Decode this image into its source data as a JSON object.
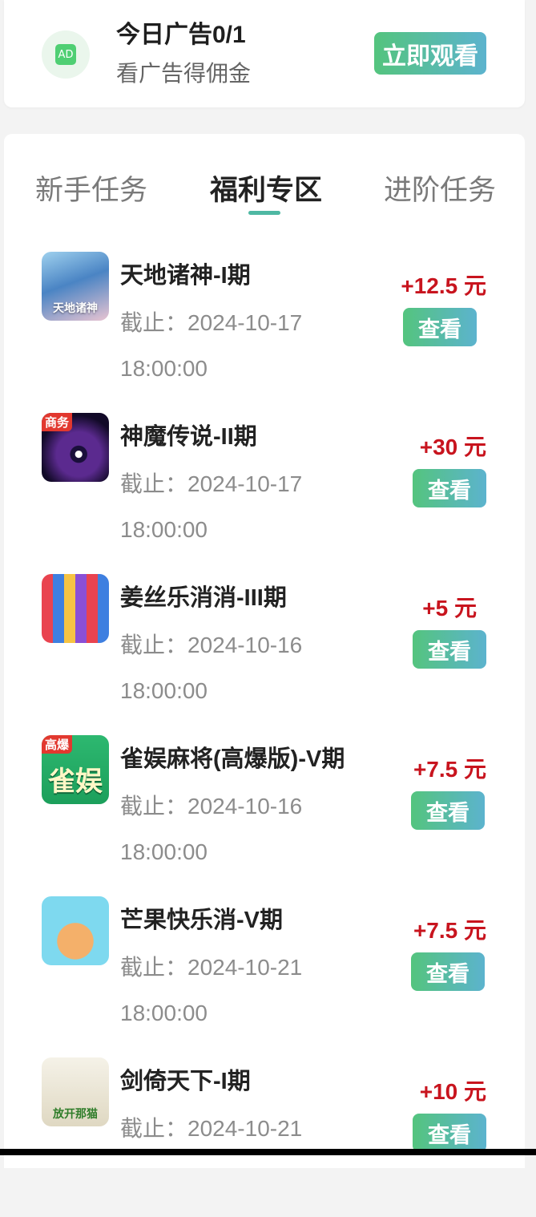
{
  "ad_card": {
    "icon_text": "AD",
    "icon_name": "ad-icon",
    "title": "今日广告0/1",
    "subtitle": "看广告得佣金",
    "watch_button": "立即观看"
  },
  "tabs": [
    {
      "label": "新手任务",
      "active": false
    },
    {
      "label": "福利专区",
      "active": true
    },
    {
      "label": "进阶任务",
      "active": false
    }
  ],
  "tasks": [
    {
      "name": "天地诸神-I期",
      "deadline_label": "截止：",
      "deadline_date": "2024-10-17",
      "deadline_time": "18:00:00",
      "reward": "+12.5 元",
      "button": "查看",
      "thumb_text": "天地诸神"
    },
    {
      "name": "神魔传说-II期",
      "deadline_label": "截止：",
      "deadline_date": "2024-10-17",
      "deadline_time": "18:00:00",
      "reward": "+30 元",
      "button": "查看",
      "thumb_text": "商务"
    },
    {
      "name": "姜丝乐消消-III期",
      "deadline_label": "截止：",
      "deadline_date": "2024-10-16",
      "deadline_time": "18:00:00",
      "reward": "+5 元",
      "button": "查看",
      "thumb_text": ""
    },
    {
      "name": "雀娱麻将(高爆版)-V期",
      "deadline_label": "截止：",
      "deadline_date": "2024-10-16",
      "deadline_time": "18:00:00",
      "reward": "+7.5 元",
      "button": "查看",
      "thumb_text": "雀娱",
      "thumb_badge": "高爆"
    },
    {
      "name": "芒果快乐消-V期",
      "deadline_label": "截止：",
      "deadline_date": "2024-10-21",
      "deadline_time": "18:00:00",
      "reward": "+7.5 元",
      "button": "查看",
      "thumb_text": ""
    },
    {
      "name": "剑倚天下-I期",
      "deadline_label": "截止：",
      "deadline_date": "2024-10-21",
      "deadline_time": "",
      "reward": "+10 元",
      "button": "查看",
      "thumb_text": "放开那猫"
    }
  ],
  "colors": {
    "accent_gradient_start": "#54c47e",
    "accent_gradient_end": "#5cb3ce",
    "reward_red": "#c8141e",
    "tab_underline": "#4eb8a3"
  }
}
